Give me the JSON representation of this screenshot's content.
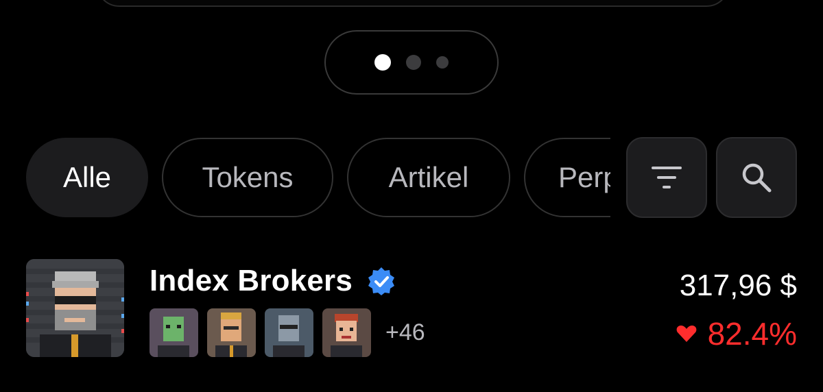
{
  "pager": {
    "pages": 3,
    "active_index": 0
  },
  "filters": {
    "chips": [
      {
        "label": "Alle",
        "active": true
      },
      {
        "label": "Tokens",
        "active": false
      },
      {
        "label": "Artikel",
        "active": false
      },
      {
        "label": "Perp",
        "active": false
      }
    ],
    "filter_icon": "filter-lines-icon",
    "search_icon": "search-icon"
  },
  "list": {
    "rows": [
      {
        "name": "Index Brokers",
        "verified": true,
        "verified_icon": "verified-badge-icon",
        "members_more": "+46",
        "price": "317,96 $",
        "change": "82.4%",
        "change_direction": "down",
        "change_icon": "heart-down-icon",
        "colors": {
          "negative": "#ff2d2d",
          "verified": "#3b8cf6"
        }
      }
    ]
  }
}
